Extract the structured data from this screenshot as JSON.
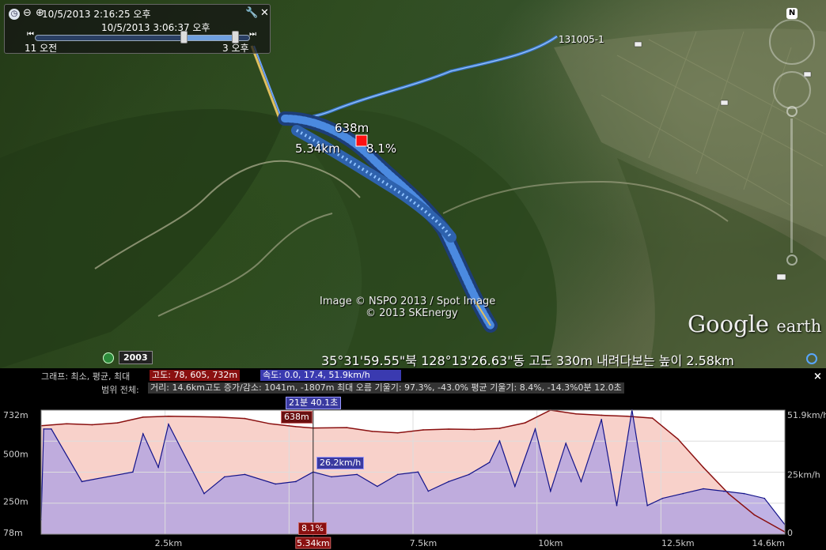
{
  "time_slider": {
    "start_datetime": "10/5/2013    2:16:25 오후",
    "end_datetime": "10/5/2013    3:06:37 오후",
    "left_tick_label": "11 오전",
    "right_tick_label": "3 오후",
    "range_start_fraction": 0.69,
    "range_end_fraction": 0.93
  },
  "map": {
    "track_name_label": "131005-1",
    "marker": {
      "elevation": "638m",
      "distance": "5.34km",
      "grade": "8.1%"
    },
    "imagery_credit": "Image © NSPO 2013 / Spot Image",
    "data_credit": "© 2013 SKEnergy",
    "logo_text": "Google",
    "logo_sub": "earth",
    "historical_year": "2003",
    "status_line": "35°31'59.55\"북  128°13'26.63\"동  고도    330m    내려다보는 높이    2.58km",
    "north_label": "N"
  },
  "profile": {
    "stats_label_graph": "그래프: 최소, 평균, 최대",
    "elevation_stats": "고도: 78, 605, 732m",
    "speed_stats": "속도: 0.0, 17.4, 51.9km/h",
    "range_label": "범위 전체:",
    "range_stats": "거리: 14.6km고도 증가/감소: 1041m, -1807m 최대 오름 기울기: 97.3%, -43.0% 평균 기울기: 8.4%, -14.3%0분 12.0초",
    "cursor_time": "21분 40.1초",
    "cursor_elevation": "638m",
    "cursor_speed": "26.2km/h",
    "cursor_grade": "8.1%",
    "cursor_distance": "5.34km",
    "close_label": "×",
    "colors": {
      "elevation": "#8a1010",
      "elevation_fill": "#f7c9c1",
      "speed": "#14148a",
      "speed_fill": "#b5a6e0"
    }
  },
  "chart_data": {
    "type": "area",
    "xlabel": "",
    "ylabel": "",
    "x_unit": "km",
    "x_ticks": [
      "2.5km",
      "5.34km",
      "7.5km",
      "10km",
      "12.5km",
      "14.6km"
    ],
    "xlim": [
      0,
      14.6
    ],
    "y_left_ticks": [
      "732m",
      "500m",
      "250m",
      "78m"
    ],
    "y_left_lim": [
      78,
      732
    ],
    "y_right_ticks": [
      "51.9km/h",
      "25km/h",
      "0"
    ],
    "y_right_lim": [
      0,
      51.9
    ],
    "grid": true,
    "series": [
      {
        "axis": "left",
        "x": [
          0,
          0.5,
          1.0,
          1.5,
          2.0,
          2.5,
          3.0,
          3.5,
          4.0,
          4.5,
          5.0,
          5.34,
          6.0,
          6.5,
          7.0,
          7.5,
          8.0,
          8.5,
          9.0,
          9.5,
          10.0,
          10.5,
          11.0,
          11.5,
          12.0,
          12.5,
          13.0,
          13.5,
          14.0,
          14.6
        ],
        "values": [
          650,
          660,
          655,
          665,
          695,
          700,
          698,
          695,
          688,
          660,
          645,
          638,
          640,
          620,
          612,
          628,
          632,
          630,
          636,
          665,
          732,
          712,
          705,
          700,
          690,
          580,
          430,
          290,
          180,
          90
        ]
      },
      {
        "axis": "right",
        "x": [
          0,
          0.05,
          0.2,
          0.8,
          1.8,
          2.0,
          2.3,
          2.5,
          3.2,
          3.6,
          4.0,
          4.6,
          5.0,
          5.34,
          5.7,
          6.2,
          6.6,
          7.0,
          7.4,
          7.6,
          8.0,
          8.4,
          8.8,
          9.0,
          9.3,
          9.7,
          10.0,
          10.3,
          10.6,
          11.0,
          11.3,
          11.6,
          11.9,
          12.2,
          12.6,
          13.0,
          13.4,
          13.8,
          14.2,
          14.6
        ],
        "values": [
          6,
          44,
          44,
          22,
          26,
          42,
          28,
          46,
          17,
          24,
          25,
          21,
          22,
          26,
          24,
          25,
          20,
          25,
          26,
          18,
          22,
          25,
          30,
          39,
          20,
          44,
          18,
          38,
          22,
          48,
          12,
          52,
          12,
          15,
          17,
          19,
          18,
          17,
          15,
          4
        ]
      }
    ]
  }
}
